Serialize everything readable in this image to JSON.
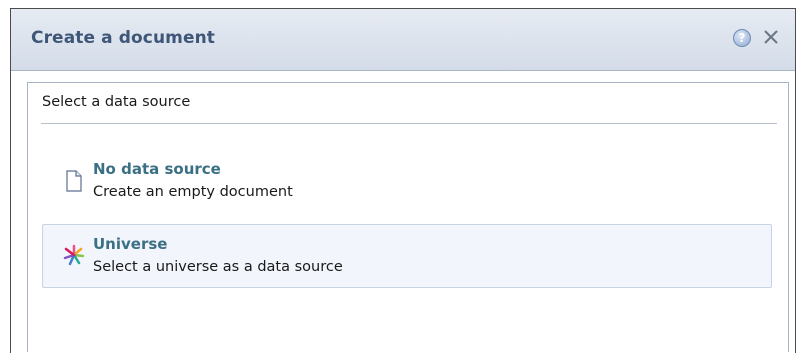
{
  "dialog": {
    "title": "Create a document",
    "help_icon": "help-icon",
    "close_icon": "close-icon"
  },
  "content": {
    "section_label": "Select a data source",
    "options": [
      {
        "title": "No data source",
        "description": "Create an empty document",
        "icon": "document-icon",
        "selected": false
      },
      {
        "title": "Universe",
        "description": "Select a universe as a data source",
        "icon": "universe-icon",
        "selected": true
      }
    ]
  },
  "colors": {
    "title_text": "#3e5677",
    "option_title": "#3b6f84",
    "selected_bg": "#f2f6fc",
    "titlebar_bg": "#dbe2ec"
  }
}
